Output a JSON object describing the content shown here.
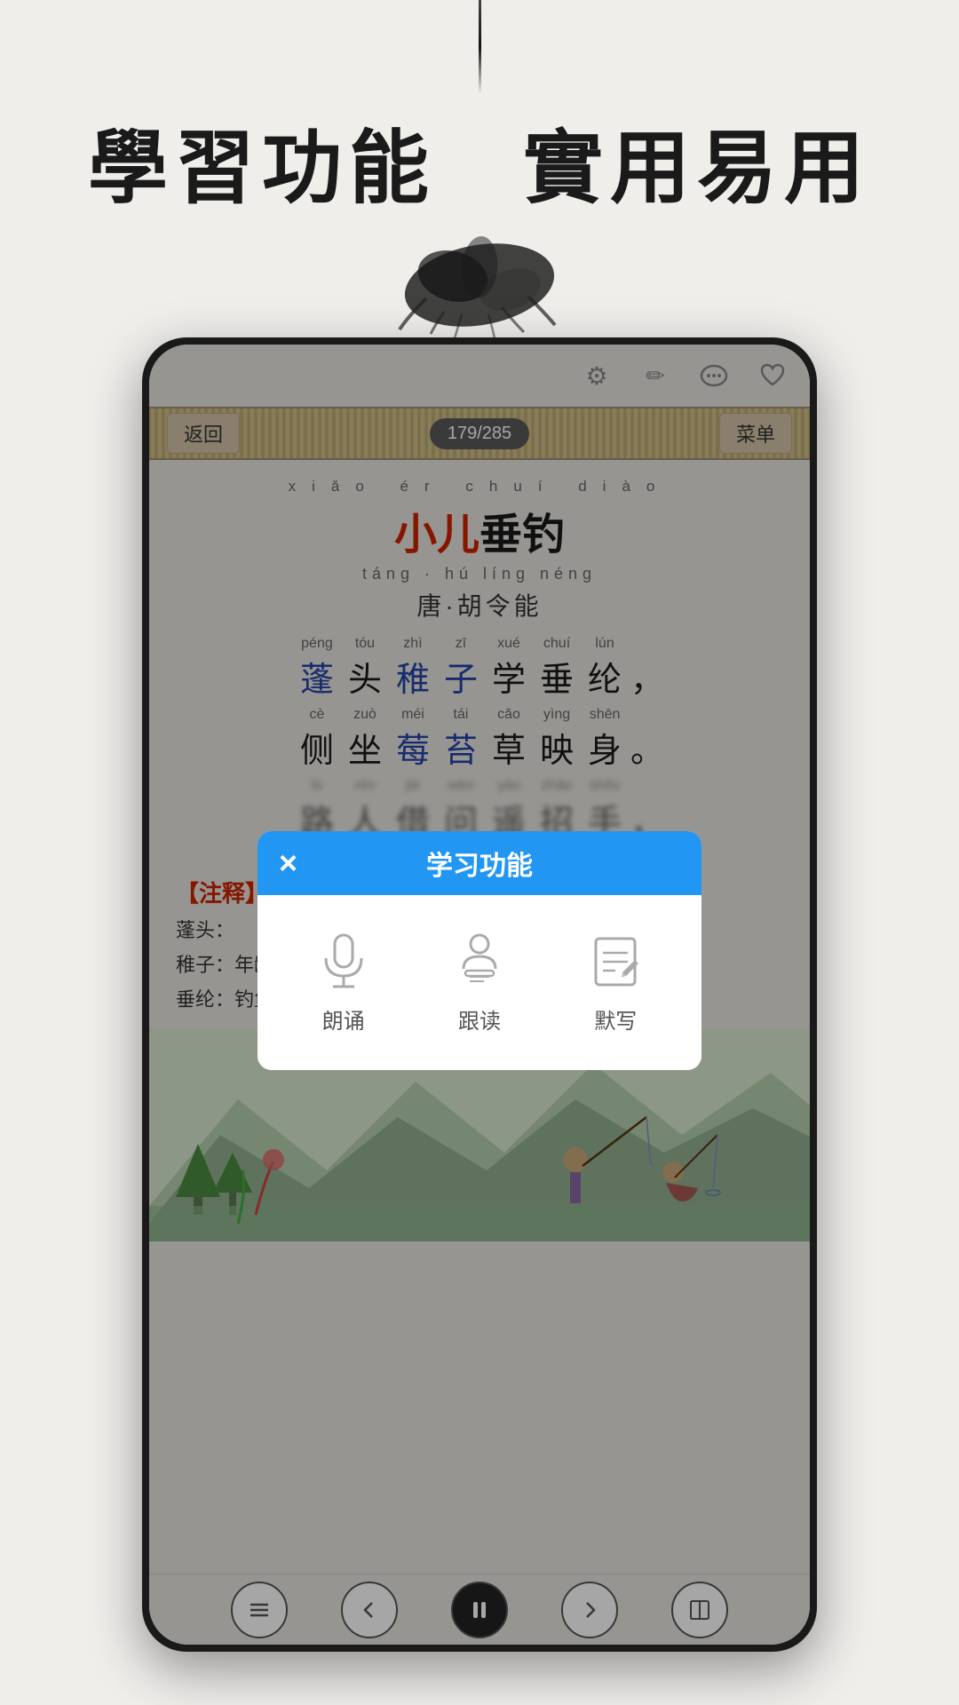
{
  "page": {
    "background_color": "#f0eeeb"
  },
  "header": {
    "title": "學習功能　實用易用",
    "ink_drop": true
  },
  "phone": {
    "nav": {
      "back_label": "返回",
      "page_indicator": "179/285",
      "menu_label": "菜单"
    },
    "poem": {
      "title_pinyin": "xiǎo  ér  chuí  diào",
      "title": "小儿垂钓",
      "title_red_chars": "小儿",
      "title_black_chars": "垂钓",
      "author_pinyin": "táng · hú  líng  néng",
      "author": "唐·胡令能",
      "lines": [
        {
          "chars": [
            {
              "pinyin": "péng",
              "char": "蓬",
              "blue": true
            },
            {
              "pinyin": "tóu",
              "char": "头",
              "blue": false
            },
            {
              "pinyin": "zhì",
              "char": "稚",
              "blue": true
            },
            {
              "pinyin": "zī",
              "char": "子",
              "blue": true
            },
            {
              "pinyin": "xué",
              "char": "学",
              "blue": false
            },
            {
              "pinyin": "chuí",
              "char": "垂",
              "blue": false
            },
            {
              "pinyin": "lún",
              "char": "纶",
              "blue": false
            }
          ],
          "punct": "，"
        },
        {
          "chars": [
            {
              "pinyin": "cè",
              "char": "侧",
              "blue": false
            },
            {
              "pinyin": "zuò",
              "char": "坐",
              "blue": false
            },
            {
              "pinyin": "méi",
              "char": "莓",
              "blue": true
            },
            {
              "pinyin": "tái",
              "char": "苔",
              "blue": true
            },
            {
              "pinyin": "cǎo",
              "char": "草",
              "blue": false
            },
            {
              "pinyin": "yìng",
              "char": "映",
              "blue": false
            },
            {
              "pinyin": "shēn",
              "char": "身",
              "blue": false
            }
          ],
          "punct": "。"
        },
        {
          "chars": [
            {
              "pinyin": "lù",
              "char": "路",
              "blue": false
            },
            {
              "pinyin": "rén",
              "char": "人",
              "blue": false
            },
            {
              "pinyin": "jiè",
              "char": "借",
              "blue": false
            },
            {
              "pinyin": "wèn",
              "char": "问",
              "blue": false
            },
            {
              "pinyin": "yáo",
              "char": "遥",
              "blue": false
            },
            {
              "pinyin": "zhāo",
              "char": "招",
              "blue": false
            },
            {
              "pinyin": "shǒu",
              "char": "手",
              "blue": false
            }
          ],
          "punct": "，",
          "blur": true
        }
      ]
    },
    "notes": {
      "header": "【注释",
      "items": [
        "蓬头：",
        "稚子：年龄小的、懵懂的孩子。",
        "垂纶：钓鱼。"
      ]
    },
    "bottom_nav": {
      "prev_label": "←",
      "play_label": "⏸",
      "next_label": "→",
      "book_label": "📖"
    }
  },
  "modal": {
    "title": "学习功能",
    "close_label": "×",
    "items": [
      {
        "icon": "microphone",
        "label": "朗诵"
      },
      {
        "icon": "person-reading",
        "label": "跟读"
      },
      {
        "icon": "pencil-writing",
        "label": "默写"
      }
    ]
  },
  "icons": {
    "gear": "⚙",
    "pen": "✏",
    "chat": "💬",
    "heart": "♡"
  }
}
